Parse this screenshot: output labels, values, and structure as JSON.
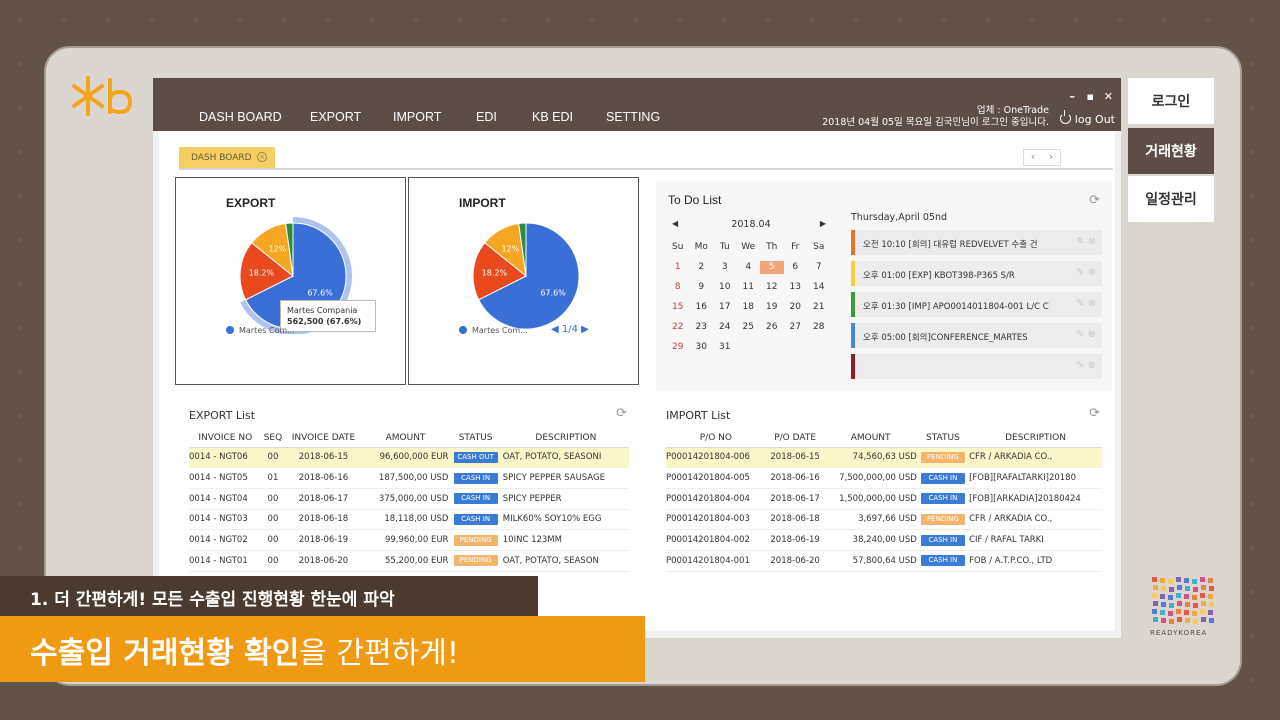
{
  "nav": {
    "items": [
      "DASH BOARD",
      "EXPORT",
      "IMPORT",
      "EDI",
      "KB EDI",
      "SETTING"
    ]
  },
  "user": {
    "company_line": "업체 : OneTrade",
    "login_line": "2018년 04월 05일 목요일 김국민님이 로그인 중입니다.",
    "logout": "log Out"
  },
  "window_controls": [
    "–",
    "▪",
    "✕"
  ],
  "side_tabs": [
    "로그인",
    "거래현황",
    "일정관리"
  ],
  "tab": {
    "label": "DASH BOARD",
    "close": "×"
  },
  "tab_arrows": [
    "‹",
    "›"
  ],
  "export_chart": {
    "title": "EXPORT",
    "legend": "Martes Com...",
    "pager": "1/4",
    "tooltip_name": "Martes Compania",
    "tooltip_value": "562,500 (67.6%)"
  },
  "import_chart": {
    "title": "IMPORT",
    "legend": "Martes Com...",
    "pager": "1/4"
  },
  "chart_data": [
    {
      "type": "pie",
      "title": "EXPORT",
      "categories": [
        "Martes Compania",
        "",
        "",
        ""
      ],
      "values": [
        67.6,
        18.2,
        12,
        2.2
      ],
      "labels": [
        "67.6%",
        "18.2%",
        "12%",
        ""
      ],
      "colors": [
        "#3a6fd8",
        "#e8491d",
        "#f5a623",
        "#2e8b3e"
      ]
    },
    {
      "type": "pie",
      "title": "IMPORT",
      "categories": [
        "Martes Compania",
        "",
        "",
        ""
      ],
      "values": [
        67.6,
        18.2,
        12,
        2.2
      ],
      "labels": [
        "67.6%",
        "18.2%",
        "12%",
        ""
      ],
      "colors": [
        "#3a6fd8",
        "#e8491d",
        "#f5a623",
        "#2e8b3e"
      ]
    }
  ],
  "todo": {
    "title": "To Do List",
    "month": "2018.04",
    "weekdays": [
      "Su",
      "Mo",
      "Tu",
      "We",
      "Th",
      "Fr",
      "Sa"
    ],
    "days": [
      "1",
      "2",
      "3",
      "4",
      "5",
      "6",
      "7",
      "8",
      "9",
      "10",
      "11",
      "12",
      "13",
      "14",
      "15",
      "16",
      "17",
      "18",
      "19",
      "20",
      "21",
      "22",
      "23",
      "24",
      "25",
      "26",
      "27",
      "28",
      "29",
      "30",
      "31"
    ],
    "selected_day": "5",
    "date_heading": "Thursday,April 05nd",
    "items": [
      {
        "text": "오전 10:10 [회의] 대유럽 REDVELVET 수출 건",
        "color": "#e8742c"
      },
      {
        "text": "오후 01:00 [EXP] KBOT398-P365 S/R",
        "color": "#f2d33a"
      },
      {
        "text": "오후 01:30 [IMP] APO0014011804-001 L/C C",
        "color": "#3a9b3a"
      },
      {
        "text": "오후 05:00 [회의]CONFERENCE_MARTES",
        "color": "#4a86d6"
      },
      {
        "text": "",
        "color": "#8b1d2c"
      }
    ]
  },
  "export_list": {
    "title": "EXPORT List",
    "columns": [
      "INVOICE NO",
      "SEQ",
      "INVOICE DATE",
      "AMOUNT",
      "STATUS",
      "DESCRIPTION"
    ],
    "rows": [
      {
        "no": "0014 - NGT06",
        "seq": "00",
        "date": "2018-06-15",
        "amount": "96,600,000 EUR",
        "status": "CASH OUT",
        "desc": "OAT, POTATO, SEASONI"
      },
      {
        "no": "0014 - NGT05",
        "seq": "01",
        "date": "2018-06-16",
        "amount": "187,500,00 USD",
        "status": "CASH IN",
        "desc": "SPICY PEPPER SAUSAGE"
      },
      {
        "no": "0014 - NGT04",
        "seq": "00",
        "date": "2018-06-17",
        "amount": "375,000,00 USD",
        "status": "CASH IN",
        "desc": "SPICY PEPPER"
      },
      {
        "no": "0014 - NGT03",
        "seq": "00",
        "date": "2018-06-18",
        "amount": "18,118,00 USD",
        "status": "CASH IN",
        "desc": "MILK60% SOY10% EGG"
      },
      {
        "no": "0014 - NGT02",
        "seq": "00",
        "date": "2018-06-19",
        "amount": "99,960,00 EUR",
        "status": "PENDING",
        "desc": "10INC 123MM"
      },
      {
        "no": "0014 - NGT01",
        "seq": "00",
        "date": "2018-06-20",
        "amount": "55,200,00 EUR",
        "status": "PENDING",
        "desc": "OAT, POTATO, SEASON"
      }
    ]
  },
  "import_list": {
    "title": "IMPORT List",
    "columns": [
      "P/O NO",
      "P/O DATE",
      "AMOUNT",
      "STATUS",
      "DESCRIPTION"
    ],
    "rows": [
      {
        "no": "P00014201804-006",
        "date": "2018-06-15",
        "amount": "74,560,63 USD",
        "status": "PENDING",
        "desc": "CFR / ARKADIA CO.,"
      },
      {
        "no": "P00014201804-005",
        "date": "2018-06-16",
        "amount": "7,500,000,00 USD",
        "status": "CASH IN",
        "desc": "[FOB][RAFALTARKI]20180"
      },
      {
        "no": "P00014201804-004",
        "date": "2018-06-17",
        "amount": "1,500,000,00 USD",
        "status": "CASH IN",
        "desc": "[FOB][ARKADIA]20180424"
      },
      {
        "no": "P00014201804-003",
        "date": "2018-06-18",
        "amount": "3,697,66 USD",
        "status": "PENDING",
        "desc": "CFR / ARKADIA CO.,"
      },
      {
        "no": "P00014201804-002",
        "date": "2018-06-19",
        "amount": "38,240,00 USD",
        "status": "CASH IN",
        "desc": "CIF / RAFAL TARKI"
      },
      {
        "no": "P00014201804-001",
        "date": "2018-06-20",
        "amount": "57,800,64 USD",
        "status": "CASH IN",
        "desc": "FOB / A.T.P.CO., LTD"
      }
    ]
  },
  "status_colors": {
    "CASH OUT": "#3a7bd5",
    "CASH IN": "#3a7bd5",
    "PENDING": "#f2b56b"
  },
  "captions": {
    "line1": "1. 더 간편하게! 모든 수출입 진행현황 한눈에 파악",
    "line2_bold": "수출입 거래현황 확인",
    "line2_light": "을 간편하게!"
  },
  "brand": {
    "readykorea": "READYKOREA"
  }
}
